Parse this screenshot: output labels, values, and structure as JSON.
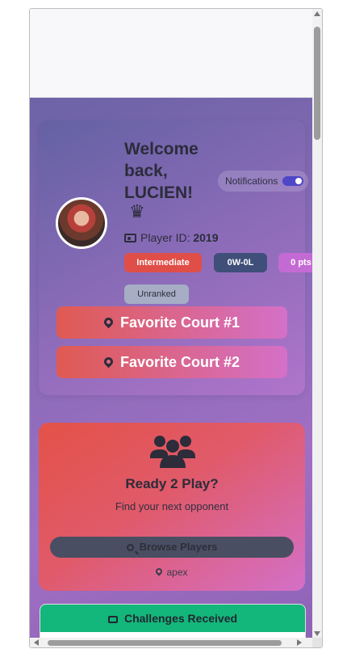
{
  "welcome": {
    "title": "Welcome back, LUCIEN!",
    "crown_icon": "♛",
    "notifications_label": "Notifications",
    "notifications_on": true,
    "player_id_label": "Player ID:",
    "player_id": "2019",
    "badges": {
      "level": "Intermediate",
      "record": "0W-0L",
      "points": "0 pts",
      "rank": "Unranked"
    },
    "courts": [
      "Favorite Court #1",
      "Favorite Court #2"
    ]
  },
  "ready": {
    "title": "Ready 2 Play?",
    "subtitle": "Find your next opponent",
    "browse_label": "Browse Players",
    "location": "apex"
  },
  "challenges": {
    "title": "Challenges Received"
  },
  "colors": {
    "level": "#e04e48",
    "record": "#3f4f79",
    "points": "#c46ad4",
    "challenges_header": "#13b67b"
  }
}
